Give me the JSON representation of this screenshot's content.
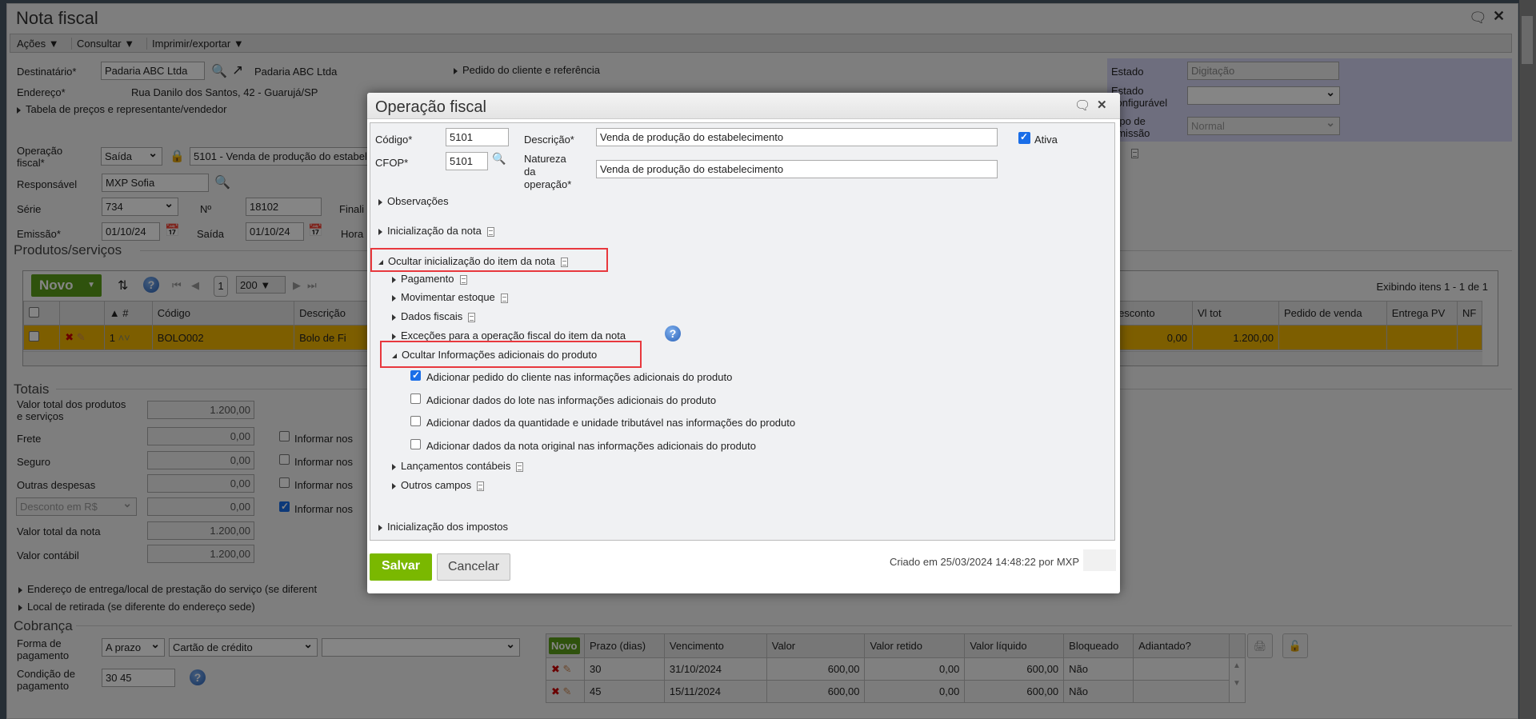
{
  "window": {
    "title": "Nota fiscal",
    "menu": [
      "Ações",
      "Consultar",
      "Imprimir/exportar"
    ]
  },
  "header": {
    "destinatario_label": "Destinatário*",
    "destinatario_value": "Padaria ABC Ltda",
    "destinatario_link": "Padaria ABC Ltda",
    "endereco_label": "Endereço*",
    "endereco_value": "Rua Danilo dos Santos, 42 - Guarujá/SP",
    "tabela_precos": "Tabela de preços e representante/vendedor",
    "pedido_cliente": "Pedido do cliente e referência",
    "operacao_label": "Operação fiscal*",
    "operacao_tipo": "Saída",
    "operacao_value": "5101 - Venda de produção do estabelecimento",
    "responsavel_label": "Responsável",
    "responsavel_value": "MXP Sofia",
    "serie_label": "Série",
    "serie_value": "734",
    "numero_label": "Nº",
    "numero_value": "18102",
    "finalidade_label": "Finali",
    "emissao_label": "Emissão*",
    "emissao_value": "01/10/24",
    "saida_label": "Saída",
    "saida_value": "01/10/24",
    "hora_label": "Hora"
  },
  "status_panel": {
    "estado_label": "Estado",
    "estado_value": "Digitação",
    "estado_config_label": "Estado configurável",
    "estado_config_value": "",
    "tipo_emissao_label": "Tipo de emissão",
    "tipo_emissao_value": "Normal"
  },
  "products": {
    "section_title": "Produtos/serviços",
    "new_button": "Novo",
    "page": "1",
    "page_size": "200",
    "showing": "Exibindo itens 1 - 1 de 1",
    "columns": [
      "#",
      "Código",
      "Descrição",
      "Desconto",
      "Vl tot",
      "Pedido de venda",
      "Entrega PV",
      "NF"
    ],
    "rows": [
      {
        "num": "1",
        "codigo": "BOLO002",
        "descricao": "Bolo de Fi",
        "desconto": "0,00",
        "vl_tot": "1.200,00",
        "pedido": "",
        "entrega": "",
        "nf": ""
      }
    ],
    "row_highlight": "#f0b400"
  },
  "totals": {
    "section_title": "Totais",
    "rows": [
      {
        "label": "Valor total dos produtos e serviços",
        "value": "1.200,00"
      },
      {
        "label": "Frete",
        "value": "0,00",
        "check_label": "Informar nos",
        "checked": false
      },
      {
        "label": "Seguro",
        "value": "0,00",
        "check_label": "Informar nos",
        "checked": false
      },
      {
        "label": "Outras despesas",
        "value": "0,00",
        "check_label": "Informar nos",
        "checked": false
      },
      {
        "label": "Desconto em R$",
        "value": "0,00",
        "check_label": "Informar nos",
        "checked": true
      },
      {
        "label": "Valor total da nota",
        "value": "1.200,00"
      },
      {
        "label": "Valor contábil",
        "value": "1.200,00"
      }
    ],
    "endereco_entrega": "Endereço de entrega/local de prestação do serviço (se diferent",
    "local_retirada": "Local de retirada (se diferente do endereço sede)"
  },
  "cobranca": {
    "section_title": "Cobrança",
    "forma_label": "Forma de pagamento",
    "forma_tipo": "A prazo",
    "forma_meio": "Cartão de crédito",
    "forma_extra": "",
    "condicao_label": "Condição de pagamento",
    "condicao_value": "30 45",
    "new_button": "Novo",
    "columns": [
      "Prazo (dias)",
      "Vencimento",
      "Valor",
      "Valor retido",
      "Valor líquido",
      "Bloqueado",
      "Adiantado?"
    ],
    "rows": [
      {
        "prazo": "30",
        "vencimento": "31/10/2024",
        "valor": "600,00",
        "retido": "0,00",
        "liquido": "600,00",
        "bloqueado": "Não",
        "adiantado": ""
      },
      {
        "prazo": "45",
        "vencimento": "15/11/2024",
        "valor": "600,00",
        "retido": "0,00",
        "liquido": "600,00",
        "bloqueado": "Não",
        "adiantado": ""
      }
    ]
  },
  "dialog": {
    "title": "Operação fiscal",
    "codigo_label": "Código*",
    "codigo_value": "5101",
    "descricao_label": "Descrição*",
    "descricao_value": "Venda de produção do estabelecimento",
    "ativa_label": "Ativa",
    "ativa_checked": true,
    "cfop_label": "CFOP*",
    "cfop_value": "5101",
    "natureza_label": "Natureza da operação*",
    "natureza_value": "Venda de produção do estabelecimento",
    "sections": {
      "observacoes": "Observações",
      "inicializacao_nota": "Inicialização da nota",
      "ocultar_item": "Ocultar inicialização do item da nota",
      "pagamento": "Pagamento",
      "movimentar": "Movimentar estoque",
      "dados_fiscais": "Dados fiscais",
      "excecoes": "Exceções para a operação fiscal do item da nota",
      "ocultar_info": "Ocultar Informações adicionais do produto",
      "lancamentos": "Lançamentos contábeis",
      "outros": "Outros campos",
      "impostos": "Inicialização dos impostos"
    },
    "options": [
      {
        "label": "Adicionar pedido do cliente nas informações adicionais do produto",
        "checked": true
      },
      {
        "label": "Adicionar dados do lote nas informações adicionais do produto",
        "checked": false
      },
      {
        "label": "Adicionar dados da quantidade e unidade tributável nas informações do produto",
        "checked": false
      },
      {
        "label": "Adicionar dados da nota original nas informações adicionais do produto",
        "checked": false
      }
    ],
    "save": "Salvar",
    "cancel": "Cancelar",
    "created": "Criado em 25/03/2024 14:48:22 por MXP",
    "highlight_color": "#e8383d",
    "save_color": "#7ab800"
  }
}
